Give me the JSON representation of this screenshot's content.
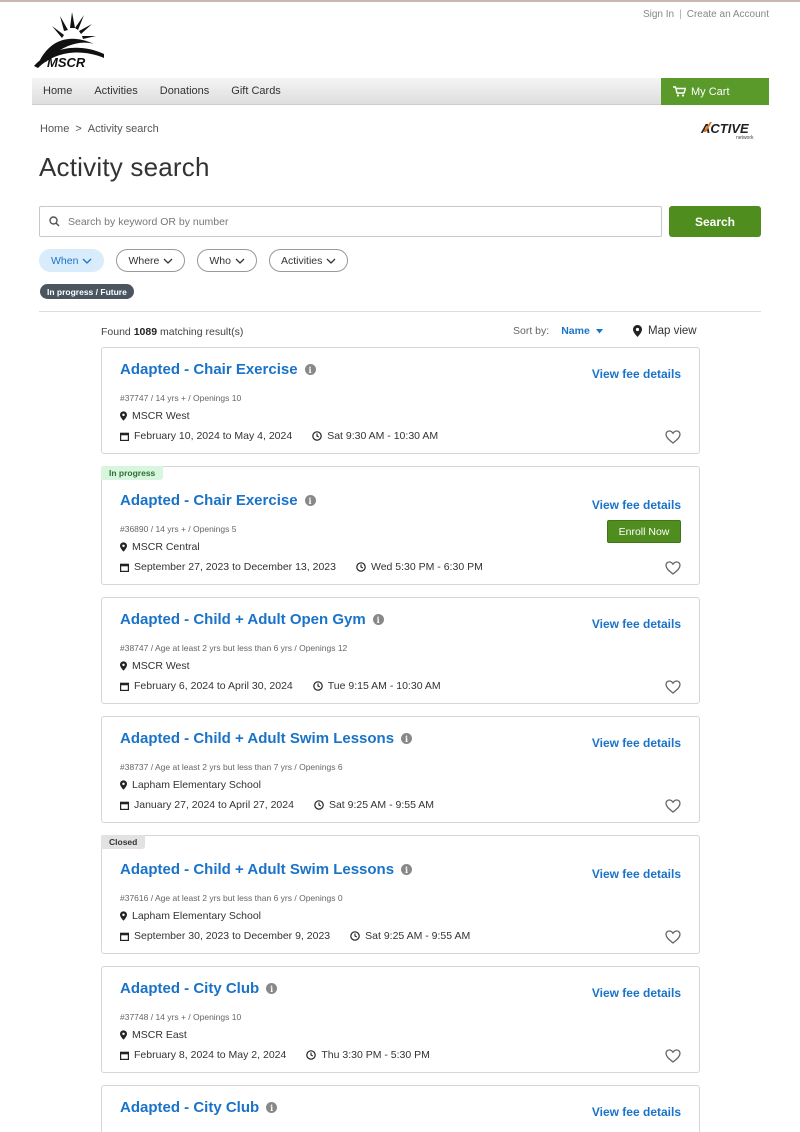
{
  "header": {
    "logo_text": "MSCR",
    "sign_in": "Sign In",
    "separator": "|",
    "create_account": "Create an Account"
  },
  "nav": {
    "items": [
      "Home",
      "Activities",
      "Donations",
      "Gift Cards"
    ],
    "cart_label": "My Cart"
  },
  "breadcrumb": {
    "home": "Home",
    "sep": ">",
    "current": "Activity search"
  },
  "brand": {
    "active_logo": "ACTIVE",
    "active_sub": "network"
  },
  "page_title": "Activity search",
  "search": {
    "placeholder": "Search by keyword OR by number",
    "button": "Search"
  },
  "filters": {
    "pills": [
      "When",
      "Where",
      "Who",
      "Activities"
    ],
    "active": "When",
    "tag": "In progress / Future"
  },
  "results": {
    "found_prefix": "Found",
    "count": "1089",
    "found_suffix": "matching result(s)",
    "sort_label": "Sort by:",
    "sort_value": "Name",
    "map_view": "Map view"
  },
  "cards": [
    {
      "status": "",
      "title": "Adapted - Chair Exercise",
      "fee": "View fee details",
      "meta": "#37747 / 14 yrs + / Openings 10",
      "location": "MSCR West",
      "dates": "February 10, 2024 to May 4, 2024",
      "time": "Sat 9:30 AM - 10:30 AM",
      "enroll": ""
    },
    {
      "status": "In progress",
      "title": "Adapted - Chair Exercise",
      "fee": "View fee details",
      "meta": "#36890 / 14 yrs + / Openings 5",
      "location": "MSCR Central",
      "dates": "September 27, 2023 to December 13, 2023",
      "time": "Wed 5:30 PM - 6:30 PM",
      "enroll": "Enroll Now"
    },
    {
      "status": "",
      "title": "Adapted - Child + Adult Open Gym",
      "fee": "View fee details",
      "meta": "#38747 / Age at least 2 yrs but less than 6 yrs / Openings 12",
      "location": "MSCR West",
      "dates": "February 6, 2024 to April 30, 2024",
      "time": "Tue 9:15 AM - 10:30 AM",
      "enroll": ""
    },
    {
      "status": "",
      "title": "Adapted - Child + Adult Swim Lessons",
      "fee": "View fee details",
      "meta": "#38737 / Age at least 2 yrs but less than 7 yrs / Openings 6",
      "location": "Lapham Elementary School",
      "dates": "January 27, 2024 to April 27, 2024",
      "time": "Sat 9:25 AM - 9:55 AM",
      "enroll": ""
    },
    {
      "status": "Closed",
      "title": "Adapted - Child + Adult Swim Lessons",
      "fee": "View fee details",
      "meta": "#37616 / Age at least 2 yrs but less than 6 yrs / Openings 0",
      "location": "Lapham Elementary School",
      "dates": "September 30, 2023 to December 9, 2023",
      "time": "Sat 9:25 AM - 9:55 AM",
      "enroll": ""
    },
    {
      "status": "",
      "title": "Adapted - City Club",
      "fee": "View fee details",
      "meta": "#37748 / 14 yrs + / Openings 10",
      "location": "MSCR East",
      "dates": "February 8, 2024 to May 2, 2024",
      "time": "Thu 3:30 PM - 5:30 PM",
      "enroll": ""
    },
    {
      "status": "",
      "title": "Adapted - City Club",
      "fee": "View fee details",
      "meta": "",
      "location": "",
      "dates": "",
      "time": "",
      "enroll": ""
    }
  ],
  "colors": {
    "link_blue": "#1a73c8",
    "green": "#4f8d1e",
    "cart_green": "#5a9a2b"
  }
}
